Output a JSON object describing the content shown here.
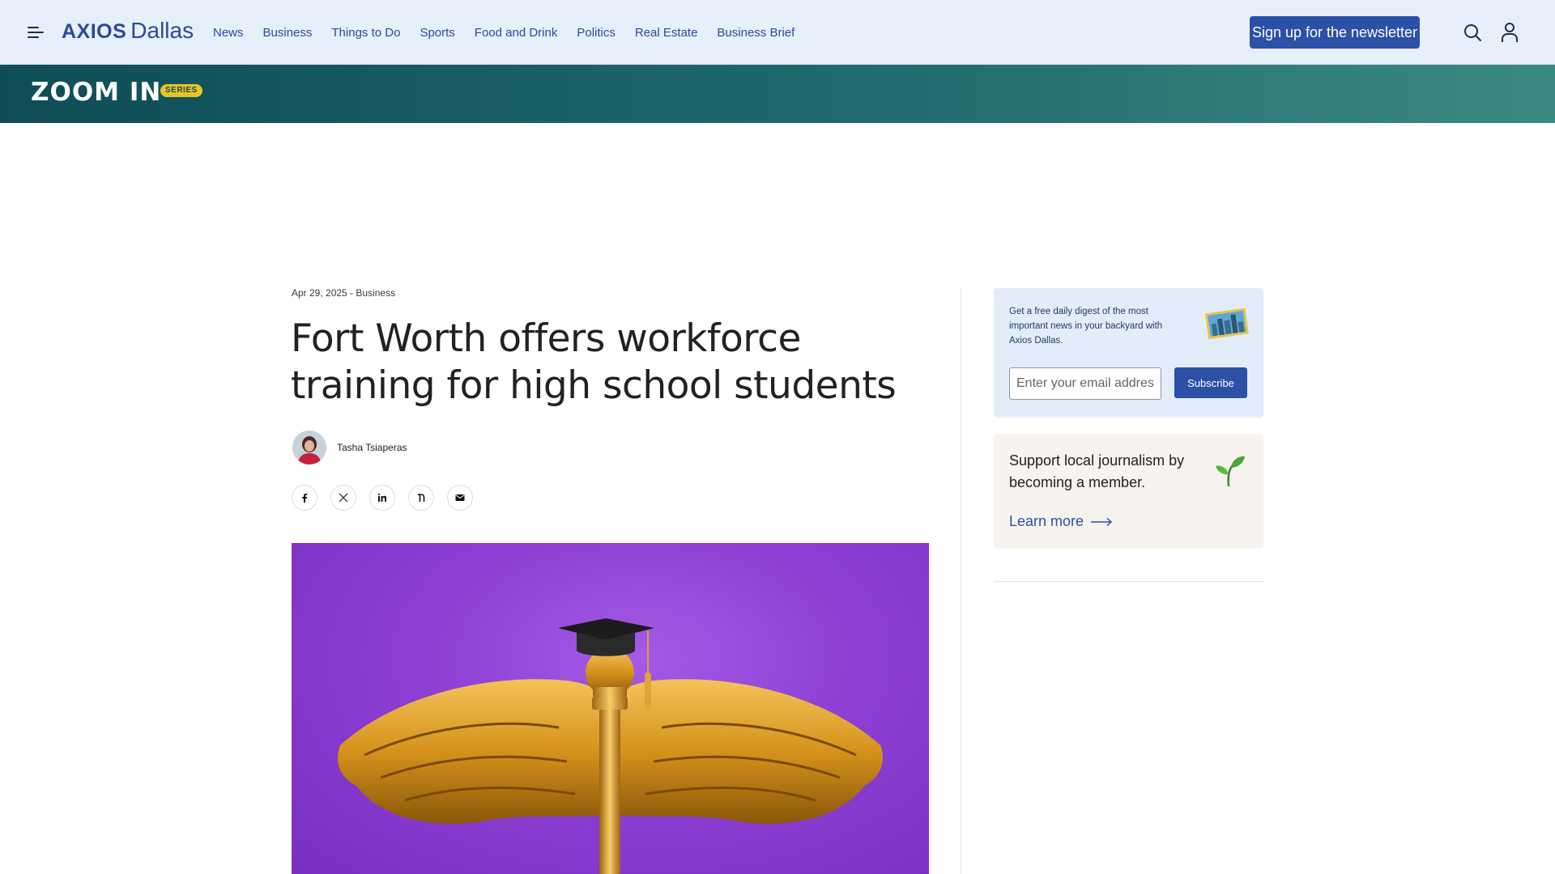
{
  "nav": {
    "logo_brand": "AXIOS",
    "logo_city": "Dallas",
    "links": [
      "News",
      "Business",
      "Things to Do",
      "Sports",
      "Food and Drink",
      "Politics",
      "Real Estate",
      "Business Brief"
    ],
    "signup_label": "Sign up for the newsletter",
    "menu_icon": "hamburger-icon",
    "search_icon": "search-icon",
    "user_icon": "user-icon"
  },
  "banner": {
    "title": "ZOOM IN",
    "badge": "SERIES"
  },
  "article": {
    "meta": "Apr 29, 2025 - Business",
    "headline": "Fort Worth offers workforce training for high school students",
    "author": "Tasha Tsiaperas",
    "share_icons": [
      "facebook-icon",
      "x-icon",
      "linkedin-icon",
      "threads-icon",
      "email-icon"
    ]
  },
  "sidebar": {
    "newsletter_text": "Get a free daily digest of the most important news in your backyard with Axios Dallas.",
    "email_placeholder": "Enter your email address",
    "subscribe_label": "Subscribe",
    "member_text": "Support local journalism by becoming a member.",
    "learn_more_label": "Learn more"
  },
  "colors": {
    "nav_bg": "#e6effa",
    "brand_blue": "#2c50a6",
    "banner_start": "#0e4d56",
    "banner_end": "#3b8a80",
    "badge_yellow": "#e6c52a",
    "hero_purple": "#8c3fd2"
  }
}
